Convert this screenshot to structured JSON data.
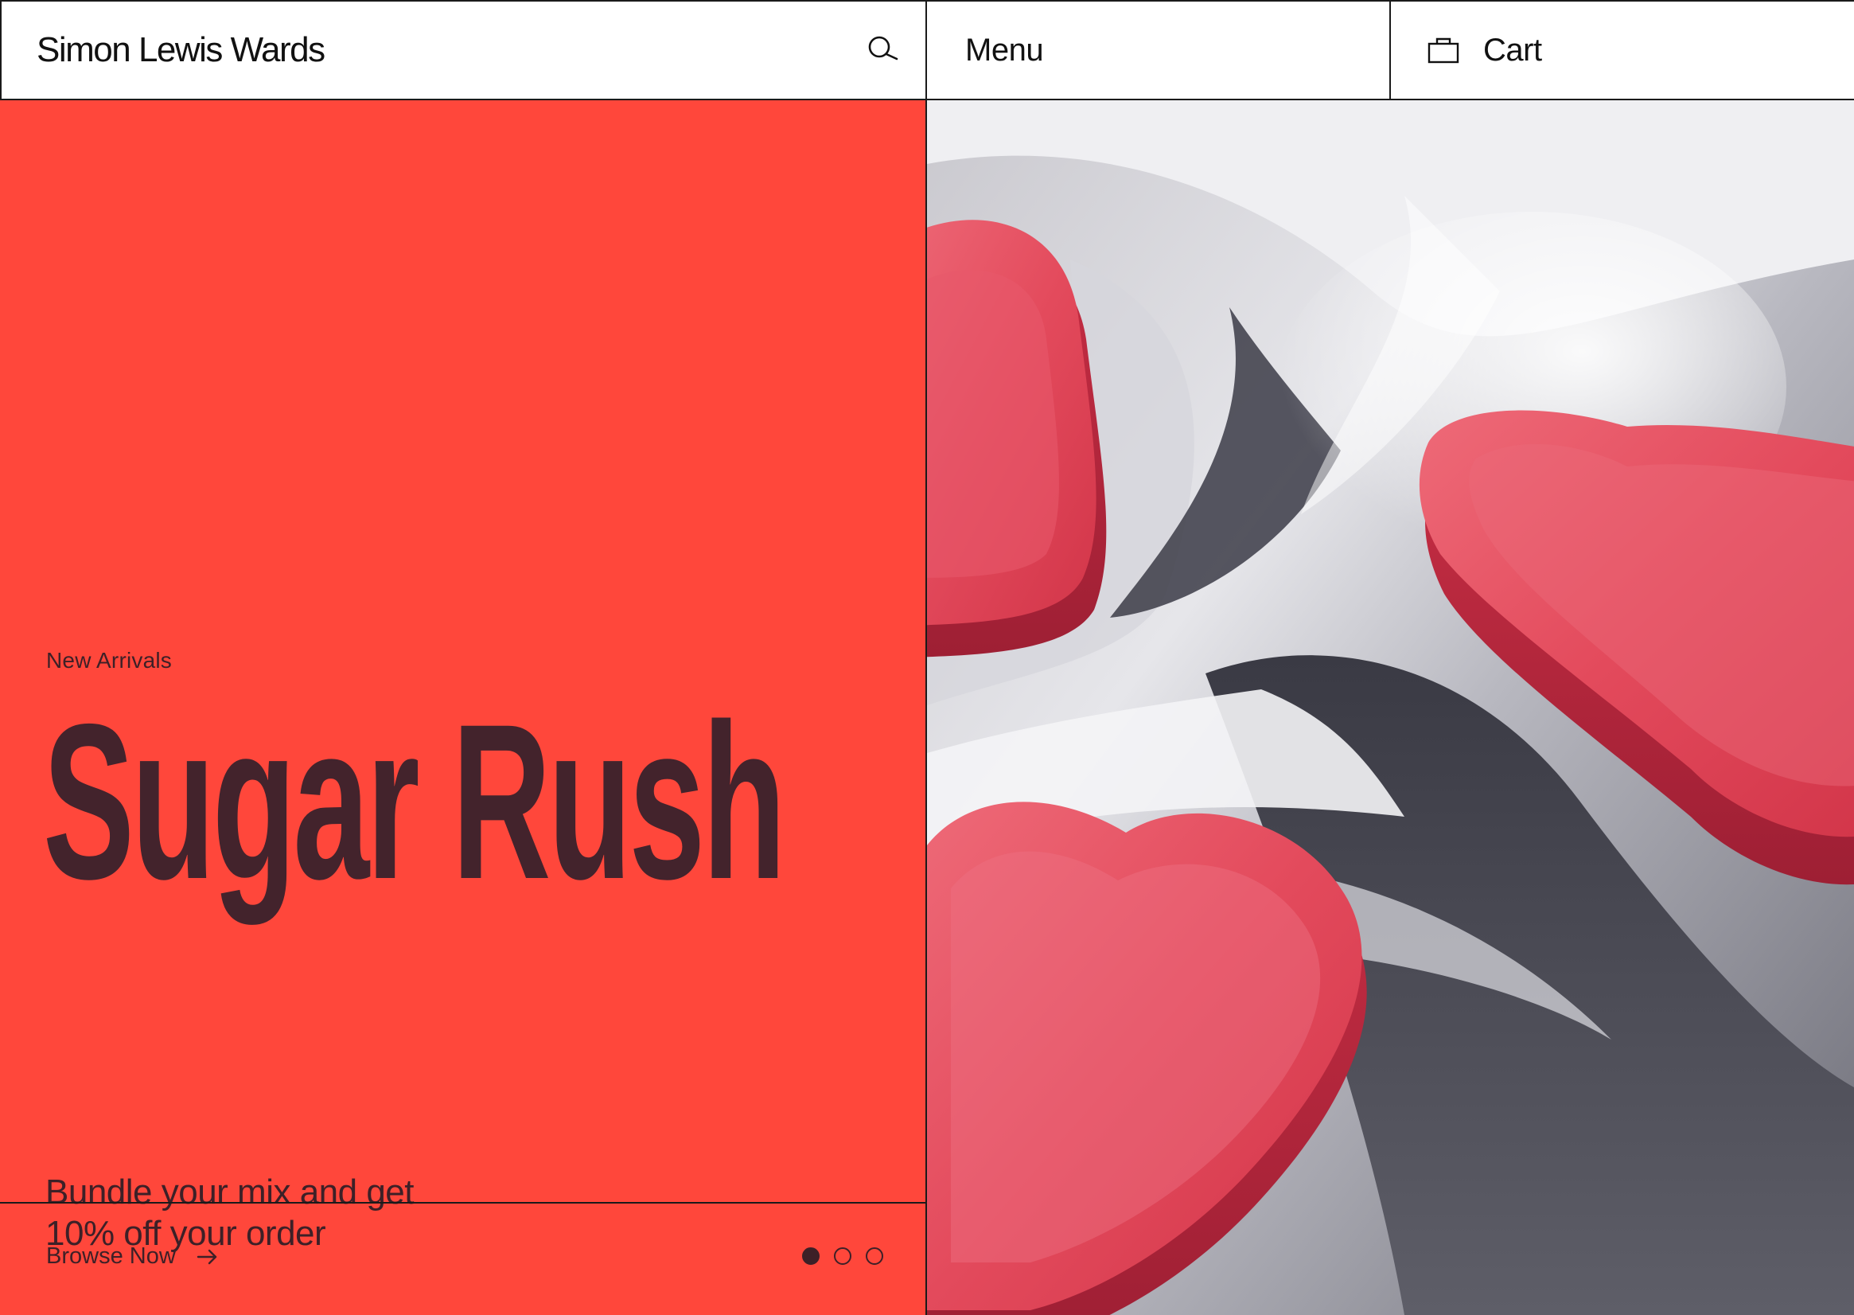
{
  "header": {
    "brand": "Simon Lewis Wards",
    "search_icon": "search-icon",
    "menu_label": "Menu",
    "cart_label": "Cart",
    "cart_icon": "shopping-bag-icon"
  },
  "hero": {
    "eyebrow": "New Arrivals",
    "headline": "Sugar Rush",
    "promo_line1": "Bundle your mix and get",
    "promo_line2": "10% off your order",
    "cta_label": "Browse Now",
    "cta_icon": "arrow-right-icon",
    "slides_total": 3,
    "slide_active": 1,
    "image_alt": "Red heart-shaped gummy candies on a silver foil background"
  },
  "colors": {
    "accent": "#ff473b",
    "text_dark": "#43232c",
    "border": "#1a1a1a",
    "candy_red": "#e2384f"
  }
}
